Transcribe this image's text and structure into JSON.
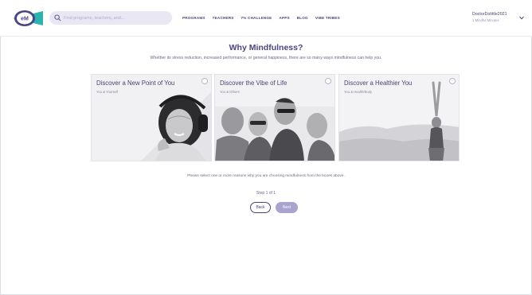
{
  "header": {
    "logo_text": "eM",
    "search": {
      "placeholder": "Find programs, teachers, and..."
    },
    "nav": [
      "PROGRAMS",
      "TEACHERS",
      "7% CHALLENGE",
      "APPS",
      "BLOG",
      "VIBE TRIBES"
    ],
    "user": {
      "name": "DoctorDolittle2021",
      "subtitle": "1 Mindful Minutes"
    }
  },
  "main": {
    "title": "Why Mindfulness?",
    "subtitle": "Whether its stress reduction, increased performance, or general happiness, there are so many ways mindfulness can help you.",
    "cards": [
      {
        "title": "Discover a New Point of You",
        "subtitle": "You & Yourself"
      },
      {
        "title": "Discover the Vibe of Life",
        "subtitle": "You & Others"
      },
      {
        "title": "Discover a Healthier You",
        "subtitle": "You & Health/Body"
      }
    ],
    "instruction": "Please select one or more reasons why you are choosing mindfulness from the boxes above.",
    "step": "Step 1 of 1",
    "back_label": "Back",
    "next_label": "Next"
  },
  "colors": {
    "brand": "#4b4585",
    "accent": "#a9a3cf",
    "search_bg": "#e9e7f3",
    "logo_teal": "#2bb3b1"
  }
}
